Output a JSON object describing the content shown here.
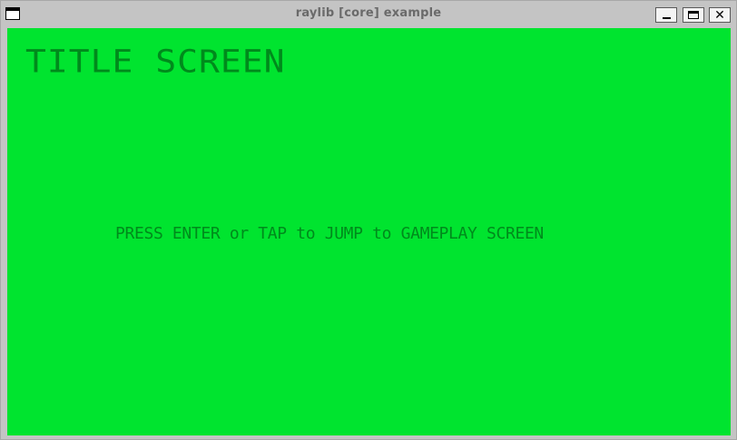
{
  "window": {
    "title": "raylib [core] example",
    "controls": {
      "minimize_icon": "minimize-icon",
      "maximize_icon": "maximize-icon",
      "close_icon": "close-icon",
      "close_glyph": "✕"
    }
  },
  "screen": {
    "background_color": "#00e42f",
    "text_color": "#008a1c",
    "title": "TITLE SCREEN",
    "prompt": "PRESS ENTER or TAP to JUMP to GAMEPLAY SCREEN"
  }
}
